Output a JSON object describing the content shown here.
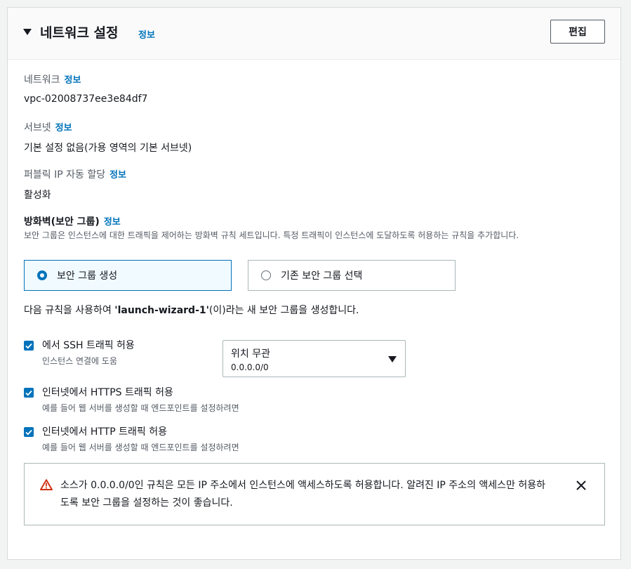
{
  "header": {
    "title": "네트워크 설정",
    "info": "정보",
    "edit_button": "편집"
  },
  "network": {
    "label": "네트워크",
    "info": "정보",
    "value": "vpc-02008737ee3e84df7"
  },
  "subnet": {
    "label": "서브넷",
    "info": "정보",
    "value": "기본 설정 없음(가용 영역의 기본 서브넷)"
  },
  "public_ip": {
    "label": "퍼블릭 IP 자동 할당",
    "info": "정보",
    "value": "활성화"
  },
  "firewall": {
    "label": "방화벽(보안 그룹)",
    "info": "정보",
    "description": "보안 그룹은 인스턴스에 대한 트래픽을 제어하는 방화벽 규칙 세트입니다. 특정 트래픽이 인스턴스에 도달하도록 허용하는 규칙을 추가합니다.",
    "options": [
      {
        "label": "보안 그룹 생성",
        "selected": true
      },
      {
        "label": "기존 보안 그룹 선택",
        "selected": false
      }
    ],
    "rule_prefix": "다음 규칙을 사용하여 ",
    "rule_name": "'launch-wizard-1'",
    "rule_suffix": "(이)라는 새 보안 그룹을 생성합니다."
  },
  "rules": [
    {
      "label": "에서 SSH 트래픽 허용",
      "desc": "인스턴스 연결에 도움",
      "checked": true
    },
    {
      "label": "인터넷에서 HTTPS 트래픽 허용",
      "desc": "예를 들어 웹 서버를 생성할 때 엔드포인트를 설정하려면",
      "checked": true
    },
    {
      "label": "인터넷에서 HTTP 트래픽 허용",
      "desc": "예를 들어 웹 서버를 생성할 때 엔드포인트를 설정하려면",
      "checked": true
    }
  ],
  "source_select": {
    "value": "위치 무관",
    "sub": "0.0.0.0/0"
  },
  "alert": {
    "text": "소스가 0.0.0.0/0인 규칙은 모든 IP 주소에서 인스턴스에 액세스하도록 허용합니다. 알려진 IP 주소의 액세스만 허용하도록 보안 그룹을 설정하는 것이 좋습니다."
  },
  "colors": {
    "link": "#0073bb",
    "warning": "#d13212",
    "selected_border": "#0073bb",
    "selected_bg": "#f1faff"
  }
}
